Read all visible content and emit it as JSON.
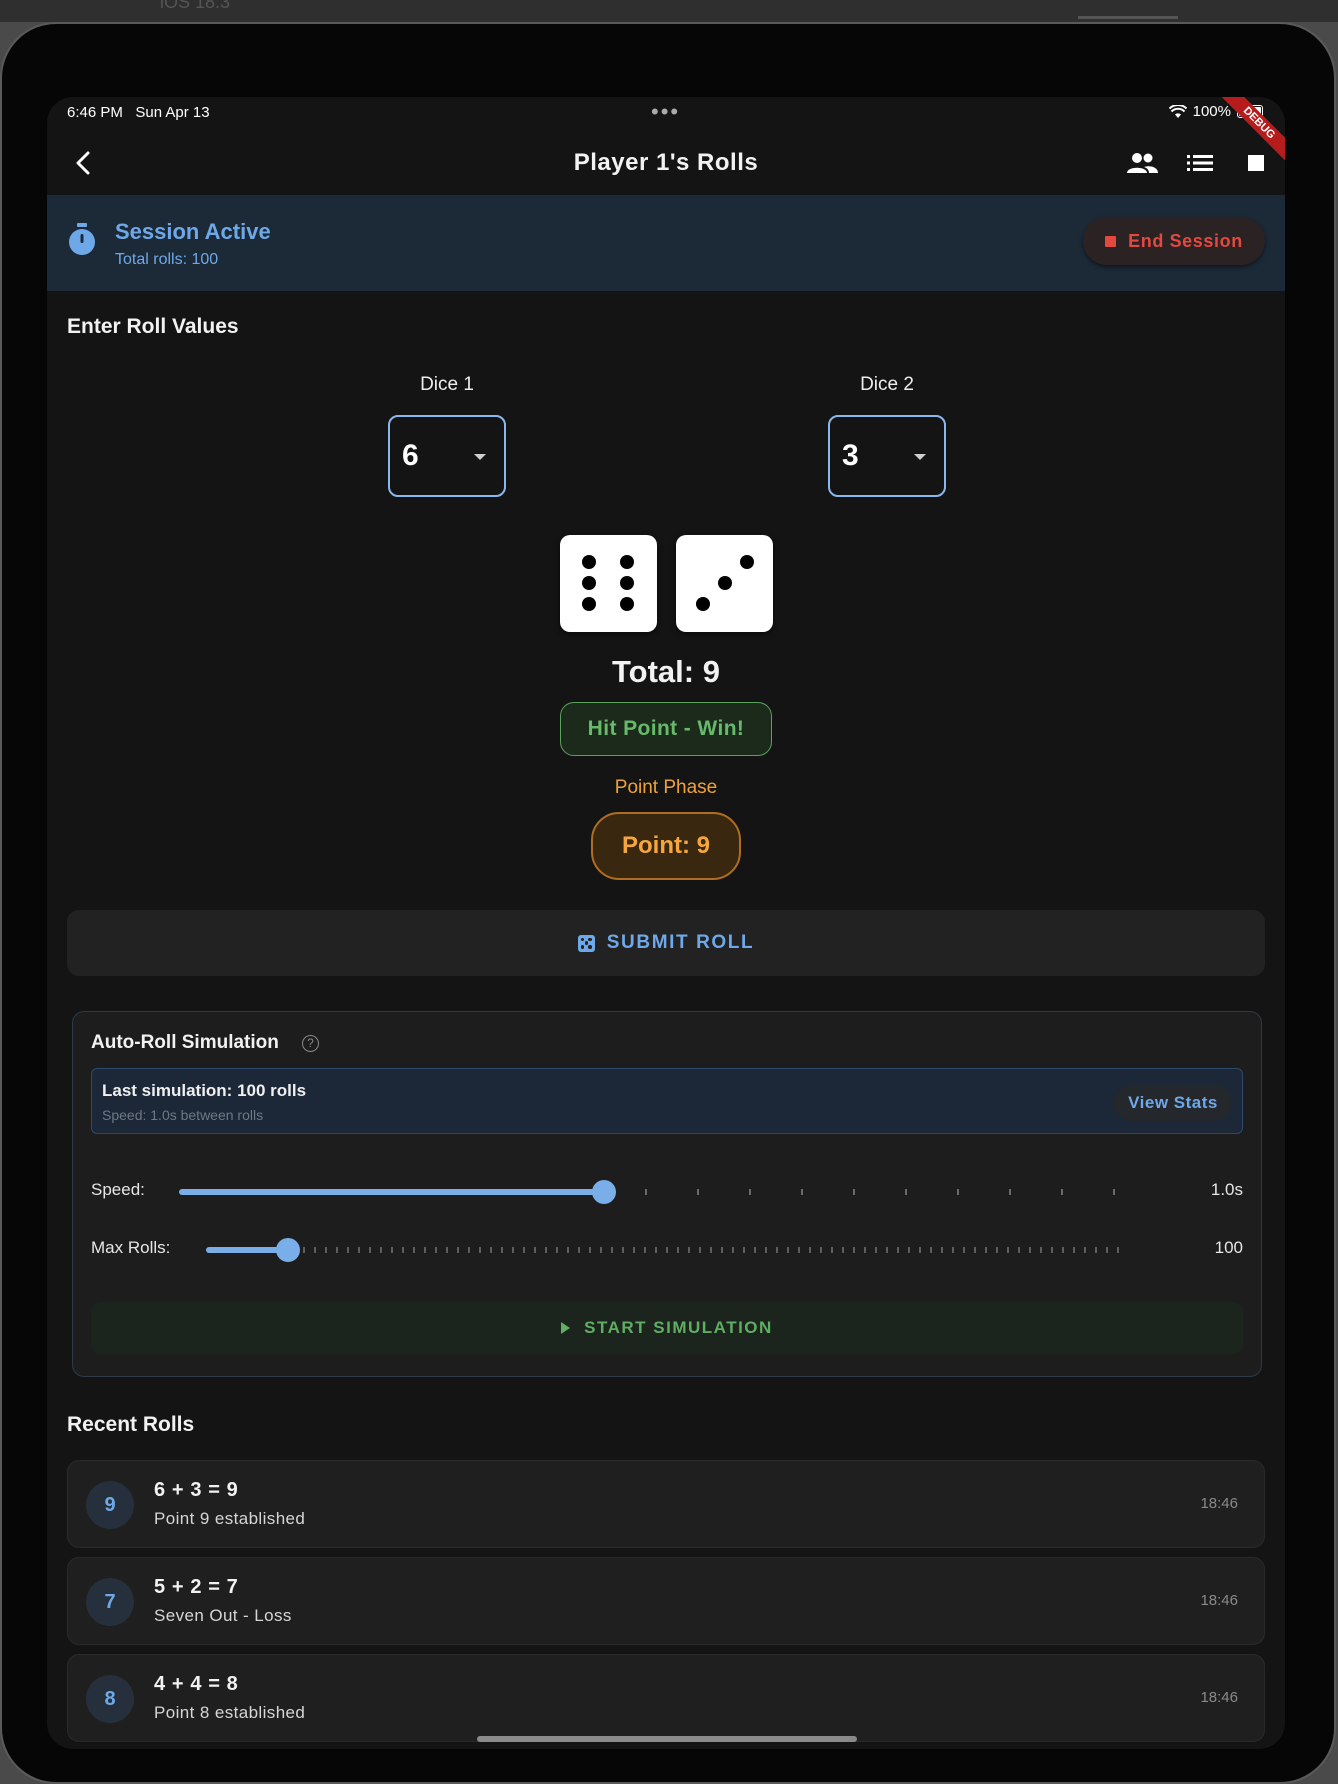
{
  "status": {
    "time": "6:46 PM",
    "date": "Sun Apr 13",
    "battery": "100%",
    "debug_banner": "DEBUG"
  },
  "appbar": {
    "title": "Player 1's Rolls",
    "icons": [
      "back-arrow-icon",
      "people-icon",
      "list-icon",
      "stop-icon"
    ]
  },
  "session": {
    "title": "Session Active",
    "subtitle": "Total rolls: 100",
    "end_label": "End Session"
  },
  "entry": {
    "heading": "Enter Roll Values",
    "dice1_label": "Dice 1",
    "dice1_value": "6",
    "dice2_label": "Dice 2",
    "dice2_value": "3",
    "total": "Total: 9",
    "result": "Hit Point - Win!",
    "phase": "Point Phase",
    "point": "Point: 9",
    "submit_label": "SUBMIT ROLL"
  },
  "auto": {
    "title": "Auto-Roll Simulation",
    "last_sim": "Last simulation: 100 rolls",
    "last_sim_sub": "Speed: 1.0s between rolls",
    "view_stats": "View Stats",
    "speed_label": "Speed:",
    "speed_value": "1.0s",
    "speed_fraction": 0.45,
    "max_label": "Max Rolls:",
    "max_value": "100",
    "max_fraction": 0.09,
    "start_label": "START SIMULATION"
  },
  "recent": {
    "heading": "Recent Rolls",
    "items": [
      {
        "total": "9",
        "equation": "6 + 3 = 9",
        "desc": "Point 9 established",
        "time": "18:46"
      },
      {
        "total": "7",
        "equation": "5 + 2 = 7",
        "desc": "Seven Out - Loss",
        "time": "18:46"
      },
      {
        "total": "8",
        "equation": "4 + 4 = 8",
        "desc": "Point 8 established",
        "time": "18:46"
      }
    ]
  },
  "colors": {
    "accent": "#6fa8e8",
    "success": "#66bb6a",
    "warning": "#f6a63d",
    "danger": "#e3493f"
  }
}
